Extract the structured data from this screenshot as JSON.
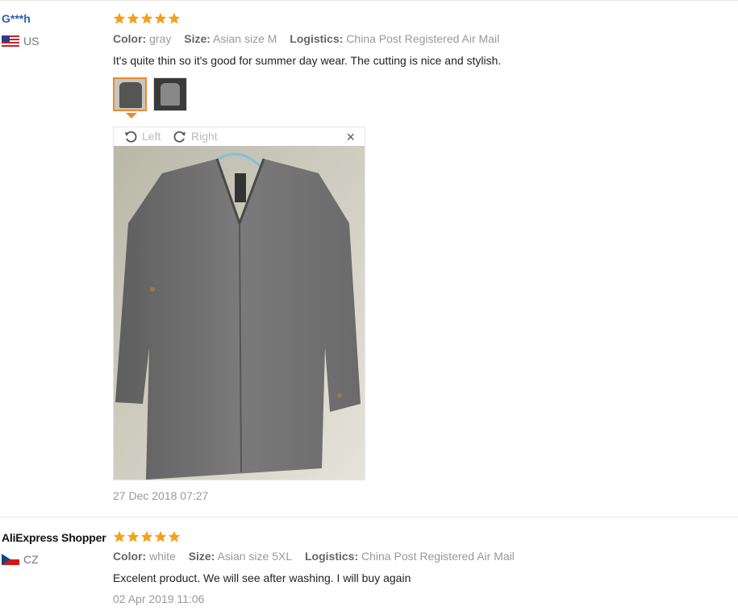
{
  "reviews": [
    {
      "user": "G***h",
      "country": "US",
      "rating": 5,
      "color_label": "Color:",
      "color_value": "gray",
      "size_label": "Size:",
      "size_value": "Asian size M",
      "logistics_label": "Logistics:",
      "logistics_value": "China Post Registered Air Mail",
      "text": "It's quite thin so it's good for summer day wear. The cutting is nice and stylish.",
      "viewer": {
        "left_label": "Left",
        "right_label": "Right",
        "close": "×"
      },
      "date": "27 Dec 2018 07:27"
    },
    {
      "user": "AliExpress Shopper",
      "country": "CZ",
      "rating": 5,
      "color_label": "Color:",
      "color_value": "white",
      "size_label": "Size:",
      "size_value": "Asian size 5XL",
      "logistics_label": "Logistics:",
      "logistics_value": "China Post Registered Air Mail",
      "text": "Excelent product. We will see after washing. I will buy again",
      "date": "02 Apr 2019 11:06"
    }
  ],
  "colors": {
    "star": "#f4a01b",
    "active_thumb": "#f08a2c",
    "user_link": "#2a5db0"
  }
}
